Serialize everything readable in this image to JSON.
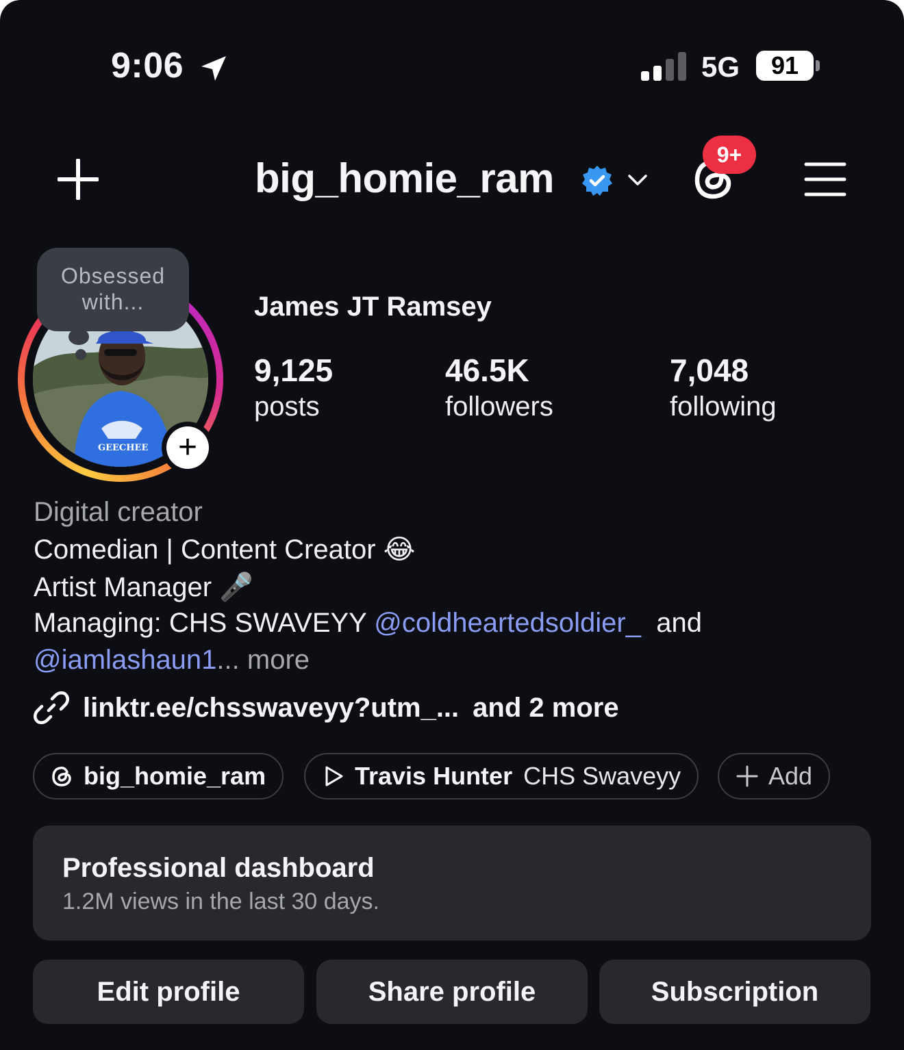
{
  "status_bar": {
    "time": "9:06",
    "network": "5G",
    "battery": "91"
  },
  "header": {
    "username": "big_homie_ram",
    "notification_count": "9+"
  },
  "avatar": {
    "note_bubble": "Obsessed with..."
  },
  "profile": {
    "full_name": "James JT Ramsey",
    "stats": [
      {
        "value": "9,125",
        "label": "posts"
      },
      {
        "value": "46.5K",
        "label": "followers"
      },
      {
        "value": "7,048",
        "label": "following"
      }
    ]
  },
  "bio": {
    "category": "Digital creator",
    "line1": "Comedian | Content Creator",
    "line1_emoji": "😂",
    "line2": "Artist Manager",
    "line2_emoji": "🎤",
    "line3_prefix": "Managing: CHS SWAVEYY",
    "mention1": "@coldheartedsoldier_",
    "line3_suffix": "and",
    "mention2": "@iamlashaun1",
    "ellipsis": "...",
    "more": "more",
    "link": "linktr.ee/chsswaveyy?utm_...",
    "link_more": "and 2 more"
  },
  "chips": {
    "threads": "big_homie_ram",
    "music_title": "Travis Hunter",
    "music_artist": "CHS Swaveyy",
    "add": "Add"
  },
  "dashboard": {
    "title": "Professional dashboard",
    "subtitle": "1.2M views in the last 30 days."
  },
  "buttons": {
    "edit": "Edit profile",
    "share": "Share profile",
    "subscription": "Subscription"
  },
  "colors": {
    "background": "#0c0e13",
    "card": "#27292e",
    "mention": "#8a9cf4",
    "badge": "#ec2f42",
    "verified": "#3897f0"
  }
}
